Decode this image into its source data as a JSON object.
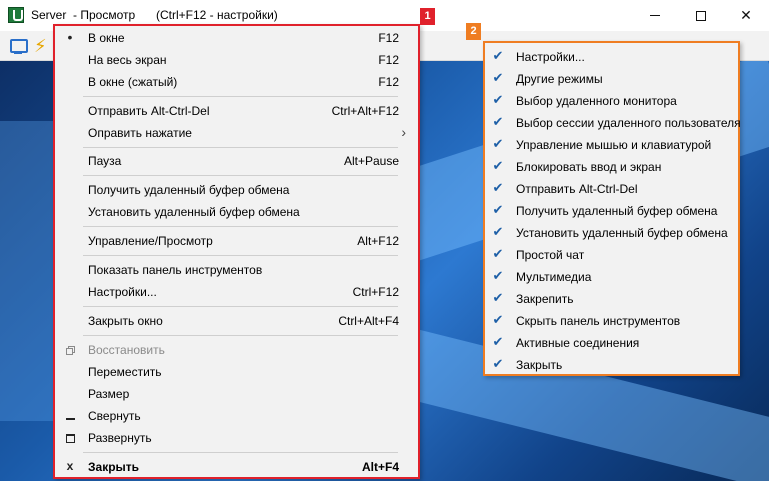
{
  "window": {
    "title": "Server  - Просмотр",
    "hint": "(Ctrl+F12 - настройки)",
    "controls": {
      "minimize": "–",
      "maximize": "☐",
      "close": "✕"
    }
  },
  "toolbar": {
    "icons": [
      "monitor-icon",
      "lightning-icon"
    ]
  },
  "badges": {
    "menu1": "1",
    "menu2": "2"
  },
  "colors": {
    "menu1_border": "#e0212b",
    "menu2_border": "#ef7d22",
    "check": "#1d5fa7"
  },
  "menu1": {
    "items": [
      {
        "label": "В окне",
        "shortcut": "F12",
        "mark": "•"
      },
      {
        "label": "На весь экран",
        "shortcut": "F12",
        "mark": ""
      },
      {
        "label": "В окне (сжатый)",
        "shortcut": "F12",
        "mark": ""
      },
      {
        "label": "Отправить Alt-Ctrl-Del",
        "shortcut": "Ctrl+Alt+F12",
        "mark": ""
      },
      {
        "label": "Оправить нажатие",
        "shortcut": "",
        "mark": "",
        "submenu": "›"
      },
      {
        "label": "Пауза",
        "shortcut": "Alt+Pause",
        "mark": ""
      },
      {
        "label": "Получить удаленный буфер обмена",
        "shortcut": "",
        "mark": ""
      },
      {
        "label": "Установить удаленный буфер обмена",
        "shortcut": "",
        "mark": ""
      },
      {
        "label": "Управление/Просмотр",
        "shortcut": "Alt+F12",
        "mark": ""
      },
      {
        "label": "Показать панель инструментов",
        "shortcut": "",
        "mark": ""
      },
      {
        "label": "Настройки...",
        "shortcut": "Ctrl+F12",
        "mark": ""
      },
      {
        "label": "Закрыть окно",
        "shortcut": "Ctrl+Alt+F4",
        "mark": ""
      },
      {
        "label": "Восстановить",
        "shortcut": "",
        "mark": "restore-icon"
      },
      {
        "label": "Переместить",
        "shortcut": "",
        "mark": ""
      },
      {
        "label": "Размер",
        "shortcut": "",
        "mark": ""
      },
      {
        "label": "Свернуть",
        "shortcut": "",
        "mark": "minimize-icon"
      },
      {
        "label": "Развернуть",
        "shortcut": "",
        "mark": "maximize-icon"
      },
      {
        "label": "Закрыть",
        "shortcut": "Alt+F4",
        "mark": "x"
      }
    ]
  },
  "menu2": {
    "check": "✔",
    "items": [
      "Настройки...",
      "Другие режимы",
      "Выбор удаленного монитора",
      "Выбор сессии удаленного пользователя",
      "Управление мышью и клавиатурой",
      "Блокировать ввод и экран",
      "Отправить Alt-Ctrl-Del",
      "Получить удаленный буфер обмена",
      "Установить удаленный буфер обмена",
      "Простой чат",
      "Мультимедиа",
      "Закрепить",
      "Скрыть панель инструментов",
      "Активные соединения",
      "Закрыть"
    ]
  }
}
